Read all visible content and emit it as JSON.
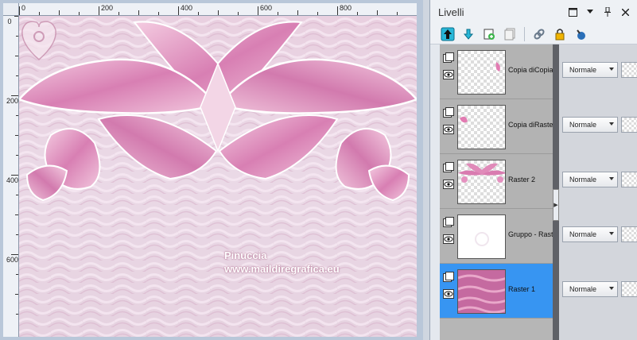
{
  "canvas": {
    "ruler_h_ticks": [
      "0",
      "200",
      "400",
      "600",
      "800"
    ],
    "ruler_v_ticks": [
      "0",
      "200",
      "400",
      "600"
    ],
    "watermark_line1": "Pinuccia",
    "watermark_line2": "www.maildiregrafica.eu"
  },
  "layers_panel": {
    "title": "Livelli",
    "title_icons": [
      "maximize-icon",
      "dropdown-icon",
      "pin-icon",
      "close-icon"
    ],
    "toolbar_icons": [
      "move-layer-up-icon",
      "move-layer-down-icon",
      "new-layer-icon",
      "duplicate-layer-icon",
      "link-icon",
      "lock-icon",
      "mask-icon"
    ],
    "layers": [
      {
        "name": "Copia diCopia",
        "blend_mode": "Normale",
        "selected": false
      },
      {
        "name": "Copia diRaster",
        "blend_mode": "Normale",
        "selected": false
      },
      {
        "name": "Raster 2",
        "blend_mode": "Normale",
        "selected": false
      },
      {
        "name": "Gruppo - Raster",
        "blend_mode": "Normale",
        "selected": false
      },
      {
        "name": "Raster 1",
        "blend_mode": "Normale",
        "selected": true
      }
    ]
  },
  "colors": {
    "accent_selected": "#3795f2",
    "canvas_pink": "#d87fb3",
    "splitter": "#5f6167"
  }
}
